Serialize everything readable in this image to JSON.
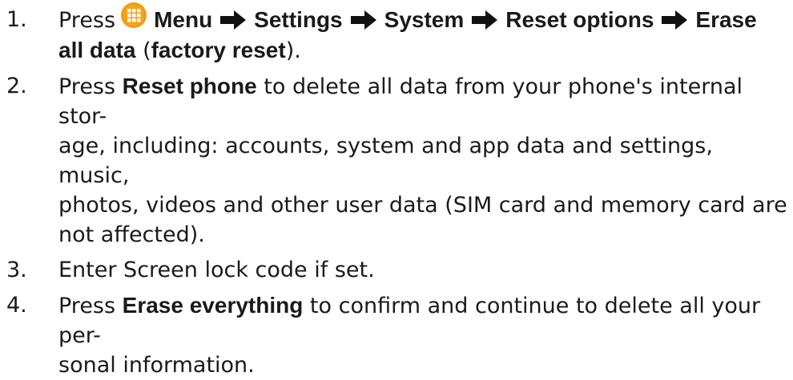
{
  "steps": [
    {
      "number": "1.",
      "parts": {
        "press": "Press",
        "menu": "Menu",
        "settings": "Settings",
        "system": "System",
        "reset_options": "Reset options",
        "erase": "Erase",
        "all_data": "all data",
        "factory_reset": "factory reset",
        "open_paren": " (",
        "close_paren": ")."
      }
    },
    {
      "number": "2.",
      "press": "Press",
      "label": "Reset phone",
      "line1": "to delete all data from your phone's internal stor-",
      "line2": "age, including: accounts, system and app data and settings, music,",
      "line3": "photos, videos and other user data (SIM card and memory card are",
      "line4": "not affected)."
    },
    {
      "number": "3.",
      "text": "Enter Screen lock code if set."
    },
    {
      "number": "4.",
      "press": "Press",
      "label": "Erase everything",
      "line1": "to confirm and continue to delete all your per-",
      "line2": "sonal information."
    }
  ],
  "icons": {
    "menu_icon": "apps-grid-icon",
    "arrow_icon": "right-arrow-icon",
    "menu_icon_color": "#f59a12",
    "arrow_color": "#111111"
  }
}
